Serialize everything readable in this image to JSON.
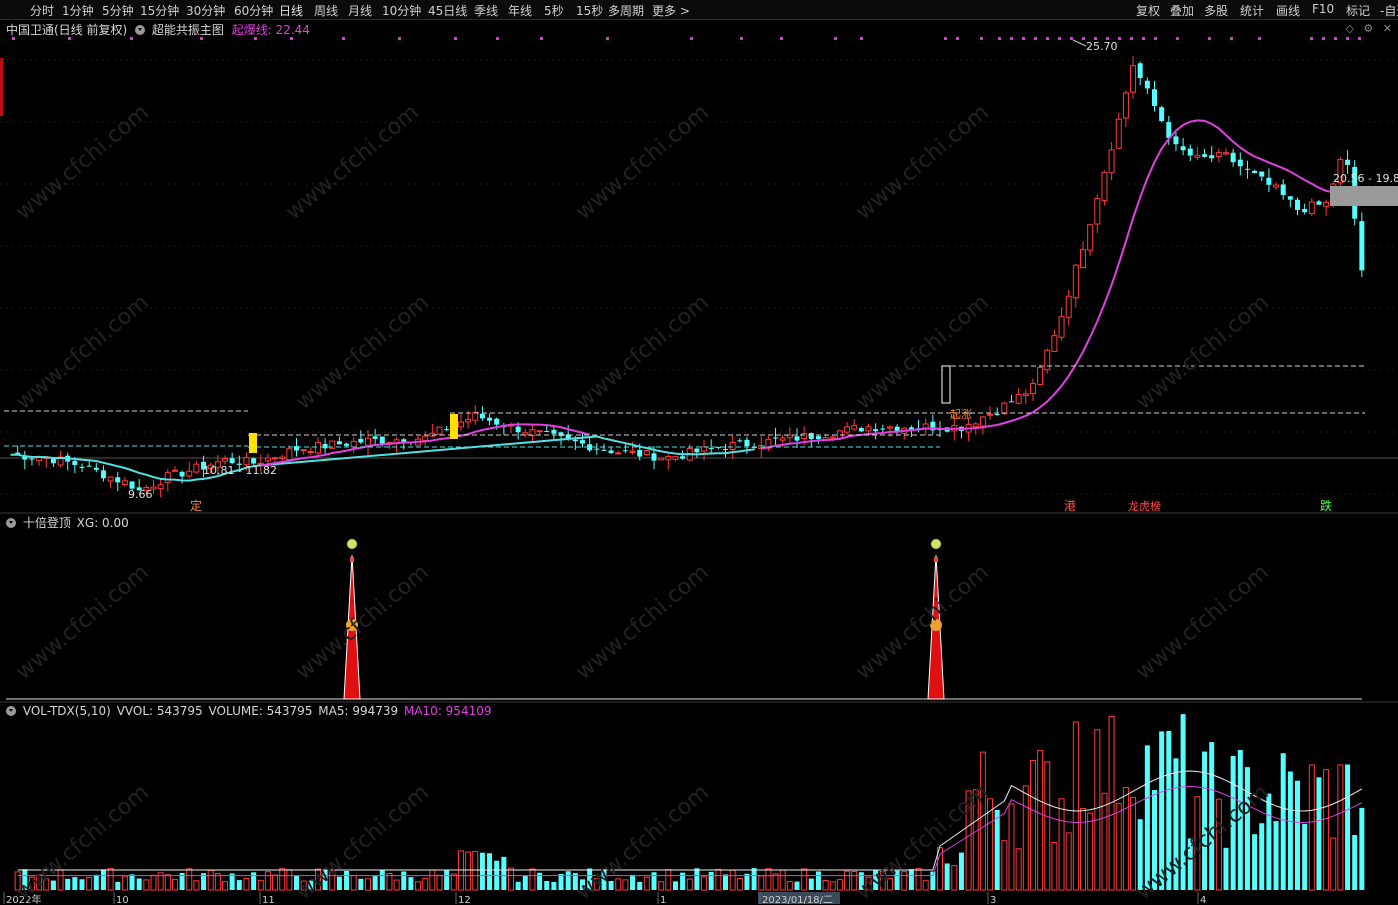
{
  "toolbar": {
    "periods": [
      "分时",
      "1分钟",
      "5分钟",
      "15分钟",
      "30分钟",
      "60分钟",
      "日线",
      "周线",
      "月线",
      "10分钟",
      "45日线",
      "季线",
      "年线",
      "5秒",
      "15秒",
      "多周期",
      "更多 >"
    ],
    "actions": [
      "复权",
      "叠加",
      "多股",
      "统计",
      "画线",
      "F10",
      "标记",
      "-自选"
    ]
  },
  "main_chart": {
    "stock_title": "中国卫通(日线 前复权)",
    "indicator_name": "超能共振主图",
    "indicator_value_label": "起爆线: 22.44",
    "high_label": "25.70",
    "low_label": "9.66",
    "range_label_left": "10.81 - 11.82",
    "range_label_right": "20.56 - 19.8",
    "tag_1": "定",
    "tag_2": "港",
    "tag_3": "龙虎榜",
    "tag_4": "跌",
    "tag_5": "起涨"
  },
  "sub_chart_1": {
    "name": "十倍登顶",
    "value": "XG: 0.00"
  },
  "sub_chart_2": {
    "name": "VOL-TDX(5,10)",
    "vvol": "VVOL: 543795",
    "volume": "VOLUME: 543795",
    "ma5": "MA5: 994739",
    "ma10": "MA10: 954109"
  },
  "x_axis": {
    "labels": [
      "2022年",
      "10",
      "11",
      "12",
      "1",
      "2023/01/18/二",
      "3",
      "4"
    ]
  },
  "watermark": "www.cfchi.com",
  "colors": {
    "up": "#ff3a3a",
    "down": "#54ffff",
    "ma_up": "#e040e0",
    "ma_down": "#54e0e0",
    "accent_magenta": "#e040e0",
    "yellow": "#ffe000"
  }
}
